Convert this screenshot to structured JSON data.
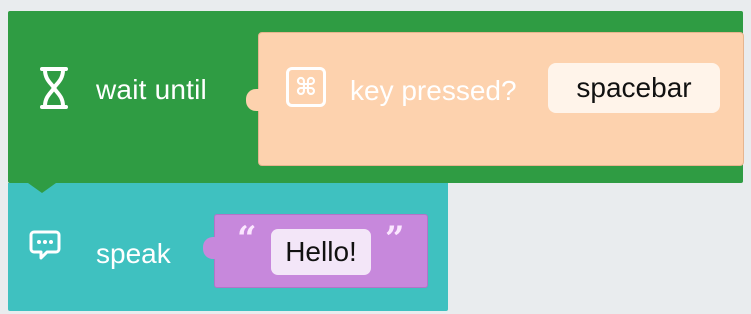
{
  "wait_block": {
    "label": "wait until",
    "icon": "hourglass-icon",
    "color": "#2f9c43"
  },
  "key_block": {
    "icon": "command-key-icon",
    "icon_glyph": "⌘",
    "label": "key pressed?",
    "selected_key": "spacebar",
    "color": "#fdd2ae"
  },
  "speak_block": {
    "icon": "speech-bubble-icon",
    "label": "speak",
    "color": "#3fc1c0"
  },
  "text_block": {
    "open_quote": "“",
    "value": "Hello!",
    "close_quote": "”",
    "color": "#c788dc"
  }
}
